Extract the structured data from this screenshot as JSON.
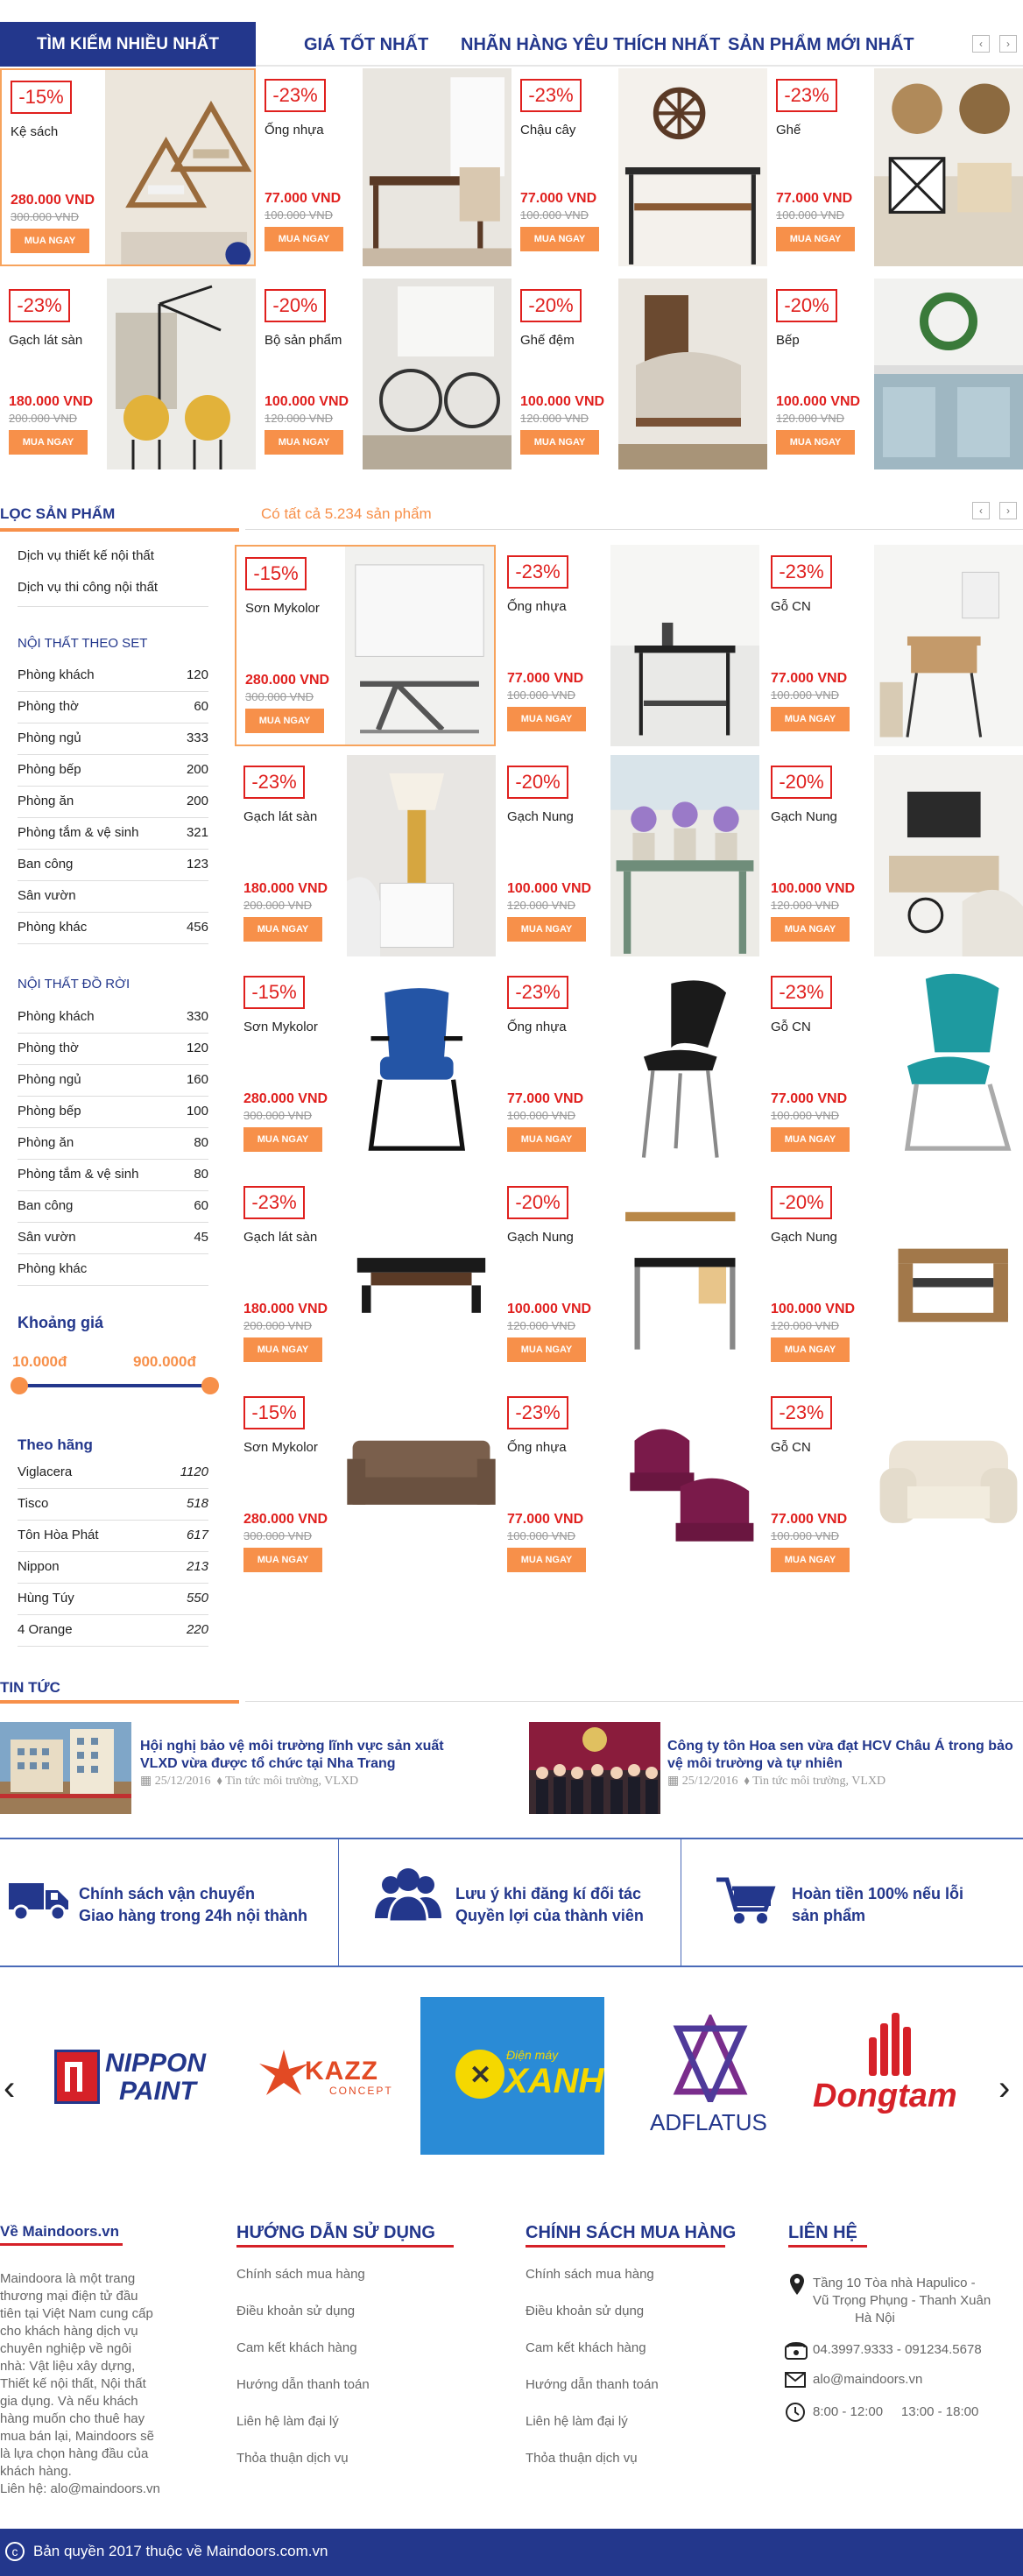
{
  "tabs": {
    "t1": "TÌM KIẾM NHIỀU NHẤT",
    "t2": "GIÁ TỐT NHẤT",
    "t3": "NHÃN HÀNG YÊU THÍCH NHẤT",
    "t4": "SẢN PHẨM MỚI NHẤT"
  },
  "nav": {
    "prev": "‹",
    "next": "›"
  },
  "buy_label": "MUA NGAY",
  "top_products": [
    {
      "discount": "-15%",
      "name": "Kệ sách",
      "price": "280.000 VND",
      "old": "300.000 VND"
    },
    {
      "discount": "-23%",
      "name": "Ống nhựa",
      "price": "77.000 VND",
      "old": "100.000 VND"
    },
    {
      "discount": "-23%",
      "name": "Chậu cây",
      "price": "77.000 VND",
      "old": "100.000 VND"
    },
    {
      "discount": "-23%",
      "name": "Ghế",
      "price": "77.000 VND",
      "old": "100.000 VND"
    },
    {
      "discount": "-23%",
      "name": "Gạch lát sàn",
      "price": "180.000 VND",
      "old": "200.000 VND"
    },
    {
      "discount": "-20%",
      "name": "Bộ sản phẩm",
      "price": "100.000 VND",
      "old": "120.000 VND"
    },
    {
      "discount": "-20%",
      "name": "Ghế đệm",
      "price": "100.000 VND",
      "old": "120.000 VND"
    },
    {
      "discount": "-20%",
      "name": "Bếp",
      "price": "100.000 VND",
      "old": "120.000 VND"
    }
  ],
  "filter": {
    "title": "LỌC SẢN PHẨM",
    "count": "Có tất cả 5.234 sản phẩm"
  },
  "services": [
    "Dịch vụ thiết kế nội thất",
    "Dịch vụ thi công nội thất"
  ],
  "set_title": "NỘI THẤT THEO SET",
  "set_items": [
    {
      "name": "Phòng khách",
      "count": "120"
    },
    {
      "name": "Phòng thờ",
      "count": "60"
    },
    {
      "name": "Phòng ngủ",
      "count": "333"
    },
    {
      "name": "Phòng bếp",
      "count": "200"
    },
    {
      "name": "Phòng ăn",
      "count": "200"
    },
    {
      "name": "Phòng tắm & vệ sinh",
      "count": "321"
    },
    {
      "name": "Ban công",
      "count": "123"
    },
    {
      "name": "Sân vườn",
      "count": ""
    },
    {
      "name": "Phòng khác",
      "count": "456"
    }
  ],
  "single_title": "NỘI THẤT ĐỒ RỜI",
  "single_items": [
    {
      "name": "Phòng khách",
      "count": "330"
    },
    {
      "name": "Phòng thờ",
      "count": "120"
    },
    {
      "name": "Phòng ngủ",
      "count": "160"
    },
    {
      "name": "Phòng bếp",
      "count": "100"
    },
    {
      "name": "Phòng ăn",
      "count": "80"
    },
    {
      "name": "Phòng tắm & vệ sinh",
      "count": "80"
    },
    {
      "name": "Ban công",
      "count": "60"
    },
    {
      "name": "Sân vườn",
      "count": "45"
    },
    {
      "name": "Phòng khác",
      "count": ""
    }
  ],
  "price_filter": {
    "title": "Khoảng giá",
    "min": "10.000đ",
    "max": "900.000đ",
    "low_fraction": 0,
    "high_fraction": 1
  },
  "brand_title": "Theo hãng",
  "brands_filter": [
    {
      "name": "Viglacera",
      "count": "1120"
    },
    {
      "name": "Tisco",
      "count": "518"
    },
    {
      "name": "Tôn Hòa Phát",
      "count": "617"
    },
    {
      "name": "Nippon",
      "count": "213"
    },
    {
      "name": "Hùng Túy",
      "count": "550"
    },
    {
      "name": "4 Orange",
      "count": "220"
    }
  ],
  "grid": [
    {
      "discount": "-15%",
      "name": "Sơn Mykolor",
      "price": "280.000 VND",
      "old": "300.000 VND"
    },
    {
      "discount": "-23%",
      "name": "Ống nhựa",
      "price": "77.000 VND",
      "old": "100.000 VND"
    },
    {
      "discount": "-23%",
      "name": "Gỗ CN",
      "price": "77.000 VND",
      "old": "100.000 VND"
    },
    {
      "discount": "-23%",
      "name": "Gạch lát sàn",
      "price": "180.000 VND",
      "old": "200.000 VND"
    },
    {
      "discount": "-20%",
      "name": "Gạch Nung",
      "price": "100.000 VND",
      "old": "120.000 VND"
    },
    {
      "discount": "-20%",
      "name": "Gạch Nung",
      "price": "100.000 VND",
      "old": "120.000 VND"
    },
    {
      "discount": "-15%",
      "name": "Sơn Mykolor",
      "price": "280.000 VND",
      "old": "300.000 VND"
    },
    {
      "discount": "-23%",
      "name": "Ống nhựa",
      "price": "77.000 VND",
      "old": "100.000 VND"
    },
    {
      "discount": "-23%",
      "name": "Gỗ CN",
      "price": "77.000 VND",
      "old": "100.000 VND"
    },
    {
      "discount": "-23%",
      "name": "Gạch lát sàn",
      "price": "180.000 VND",
      "old": "200.000 VND"
    },
    {
      "discount": "-20%",
      "name": "Gạch Nung",
      "price": "100.000 VND",
      "old": "120.000 VND"
    },
    {
      "discount": "-20%",
      "name": "Gạch Nung",
      "price": "100.000 VND",
      "old": "120.000 VND"
    },
    {
      "discount": "-15%",
      "name": "Sơn Mykolor",
      "price": "280.000 VND",
      "old": "300.000 VND"
    },
    {
      "discount": "-23%",
      "name": "Ống nhựa",
      "price": "77.000 VND",
      "old": "100.000 VND"
    },
    {
      "discount": "-23%",
      "name": "Gỗ CN",
      "price": "77.000 VND",
      "old": "100.000 VND"
    }
  ],
  "news": {
    "title": "TIN TỨC",
    "items": [
      {
        "title": "Hội nghị bảo vệ môi trường lĩnh vực sản xuất VLXD vừa được tổ chức tại Nha Trang",
        "date": "25/12/2016",
        "tags": "Tin tức môi trường, VLXD"
      },
      {
        "title": "Công ty tôn Hoa sen vừa đạt HCV Châu Á trong bảo vệ môi trường và tự nhiên",
        "date": "25/12/2016",
        "tags": "Tin tức môi trường, VLXD"
      }
    ]
  },
  "policies": [
    {
      "line1": "Chính sách vận chuyển",
      "line2": "Giao hàng trong 24h nội thành",
      "icon": "truck-icon"
    },
    {
      "line1": "Lưu ý khi đăng kí đối tác",
      "line2": "Quyền lợi của thành viên",
      "icon": "users-icon"
    },
    {
      "line1": "Hoàn tiền 100% nếu lỗi",
      "line2": "sản phẩm",
      "icon": "cart-icon"
    }
  ],
  "partner_logos": {
    "nippon1": "NIPPON",
    "nippon2": "PAINT",
    "kazz": "KAZZ",
    "kazz_sub": "CONCEPT",
    "xanh_small": "Điện máy",
    "xanh": "XANH",
    "adflatus": "ADFLATUS",
    "dongtam": "Dongtam"
  },
  "footer": {
    "about_title": "Về Maindoors.vn",
    "about_text": [
      "Maindoora là một trang",
      "thương mại điện tử đầu",
      "tiên tại Việt Nam cung cấp",
      "cho khách hàng dịch vụ",
      "chuyên nghiệp về ngôi",
      "nhà: Vật liệu xây dựng,",
      "Thiết kế nội thất, Nội thất",
      "gia dụng. Và nếu khách",
      "hàng muốn cho thuê hay",
      "mua bán lại, Maindoors sẽ",
      "là lựa chọn hàng đầu của",
      "khách hàng.",
      "Liên hệ: alo@maindoors.vn"
    ],
    "guide_title": "HƯỚNG DẪN SỬ DỤNG",
    "guide": [
      "Chính sách mua hàng",
      "Điều khoản sử dụng",
      "Cam kết khách hàng",
      "Hướng dẫn thanh toán",
      "Liên hệ làm đại lý",
      "Thỏa thuận dịch vụ"
    ],
    "policy_title": "CHÍNH SÁCH MUA HÀNG",
    "policy": [
      "Chính sách mua hàng",
      "Điều khoản sử dụng",
      "Cam kết khách hàng",
      "Hướng dẫn thanh toán",
      "Liên hệ làm đại lý",
      "Thỏa thuận dịch vụ"
    ],
    "contact_title": "LIÊN HỆ",
    "address": [
      "Tầng 10 Tòa nhà Hapulico -",
      "Vũ Trọng Phụng - Thanh Xuân",
      "Hà Nội"
    ],
    "phone": "04.3997.9333 - 091234.5678",
    "email": "alo@maindoors.vn",
    "hours": "8:00 - 12:00     13:00 - 18:00"
  },
  "copyright": "Bản quyền 2017 thuộc về Maindoors.com.vn",
  "colors": {
    "navy": "#23378c",
    "red": "#e0201e",
    "orange": "#f7904a"
  }
}
